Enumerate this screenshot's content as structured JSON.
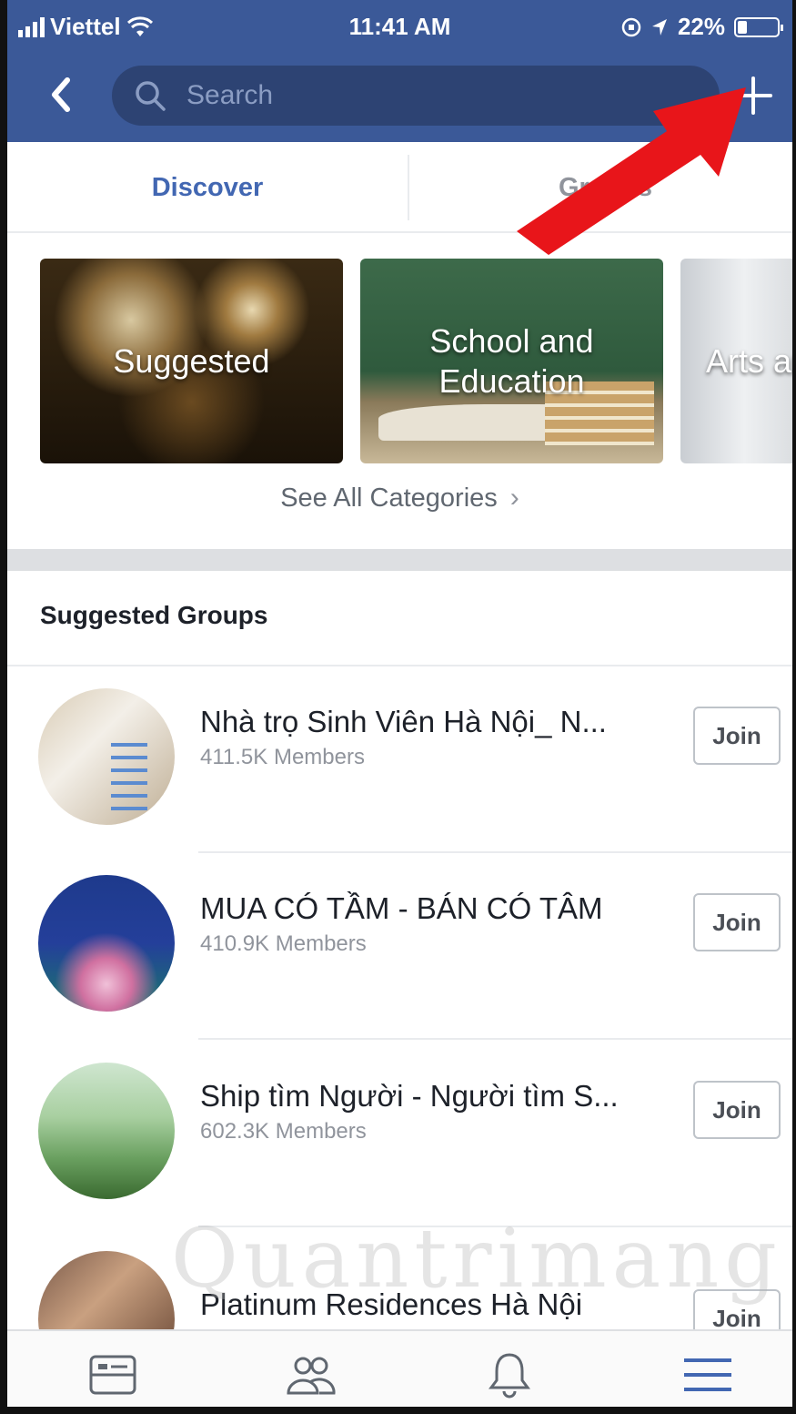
{
  "status_bar": {
    "carrier": "Viettel",
    "time": "11:41 AM",
    "battery": "22%"
  },
  "nav": {
    "search_placeholder": "Search"
  },
  "tabs": [
    {
      "label": "Discover",
      "active": true
    },
    {
      "label": "Groups",
      "active": false
    }
  ],
  "categories": [
    {
      "label_line1": "Suggested",
      "label_line2": ""
    },
    {
      "label_line1": "School and",
      "label_line2": "Education"
    },
    {
      "label_line1": "Arts ar",
      "label_line2": ""
    }
  ],
  "see_all": "See All Categories",
  "suggested_groups": {
    "title": "Suggested Groups",
    "items": [
      {
        "name": "Nhà trọ Sinh Viên Hà Nội_ N...",
        "members": "411.5K Members",
        "button": "Join"
      },
      {
        "name": "MUA CÓ TẦM - BÁN CÓ TÂM",
        "members": "410.9K Members",
        "button": "Join"
      },
      {
        "name": "Ship tìm Người - Người tìm S...",
        "members": "602.3K Members",
        "button": "Join"
      },
      {
        "name": "Platinum Residences Hà Nội",
        "members": "",
        "button": "Join"
      }
    ]
  },
  "watermark": "Quantrimang",
  "colors": {
    "header": "#3b5998",
    "accent": "#4267b2",
    "arrow": "#e8151a"
  }
}
